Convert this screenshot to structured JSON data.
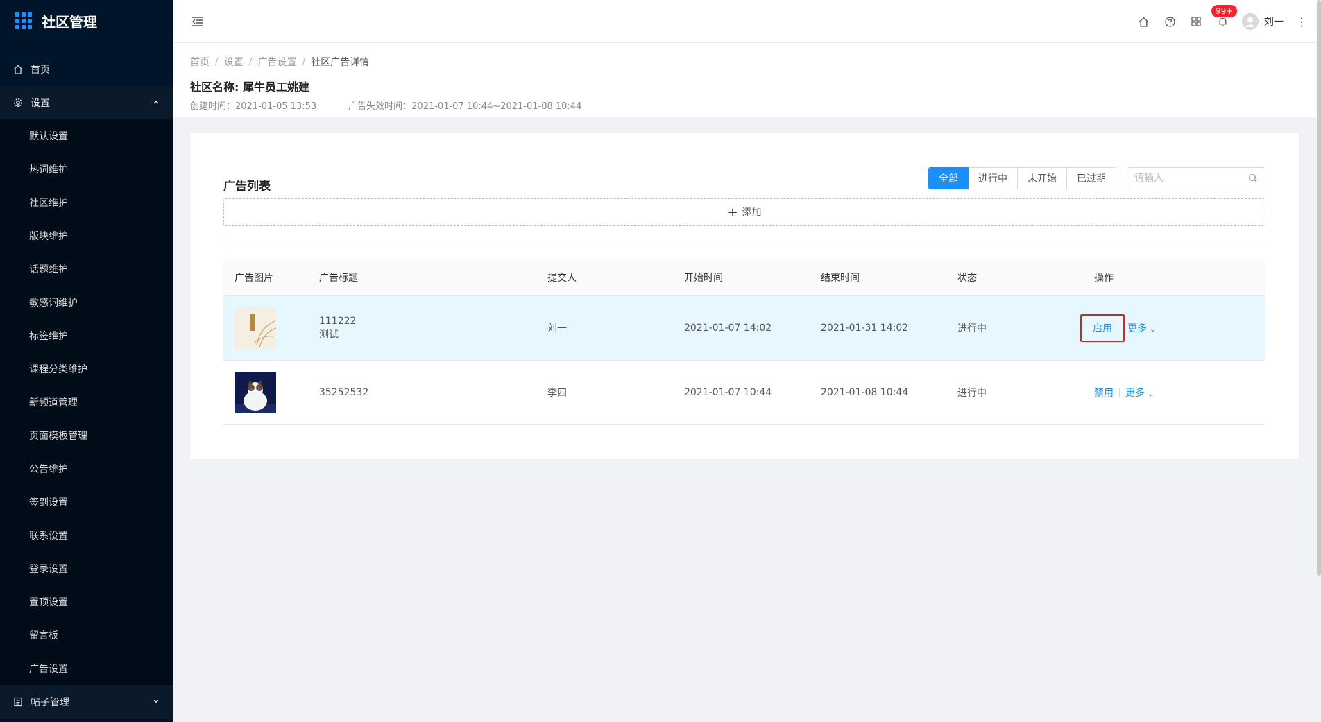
{
  "app": {
    "title": "社区管理"
  },
  "sidebar": {
    "home": "首页",
    "settings": "设置",
    "settings_items": [
      "默认设置",
      "热词维护",
      "社区维护",
      "版块维护",
      "话题维护",
      "敏感词维护",
      "标签维护",
      "课程分类维护",
      "新频道管理",
      "页面模板管理",
      "公告维护",
      "签到设置",
      "联系设置",
      "登录设置",
      "置顶设置",
      "留言板",
      "广告设置"
    ],
    "posts": "帖子管理"
  },
  "header": {
    "badge": "99+",
    "username": "刘一"
  },
  "breadcrumb": [
    "首页",
    "设置",
    "广告设置",
    "社区广告详情"
  ],
  "community": {
    "name_line": "社区名称:  犀牛员工姚建",
    "created": "创建时间：2021-01-05 13:53",
    "expire": "广告失效时间：2021-01-07 10:44~2021-01-08 10:44"
  },
  "list": {
    "title": "广告列表",
    "filters": [
      "全部",
      "进行中",
      "未开始",
      "已过期"
    ],
    "search_placeholder": "请输入",
    "add_label": "添加",
    "columns": [
      "广告图片",
      "广告标题",
      "提交人",
      "开始时间",
      "结束时间",
      "状态",
      "操作"
    ],
    "rows": [
      {
        "title": "111222",
        "subtitle": "测试",
        "submitter": "刘一",
        "start": "2021-01-07 14:02",
        "end": "2021-01-31 14:02",
        "status": "进行中",
        "action": "启用",
        "more": "更多"
      },
      {
        "title": "35252532",
        "subtitle": "",
        "submitter": "李四",
        "start": "2021-01-07 10:44",
        "end": "2021-01-08 10:44",
        "status": "进行中",
        "action": "禁用",
        "more": "更多"
      }
    ]
  }
}
